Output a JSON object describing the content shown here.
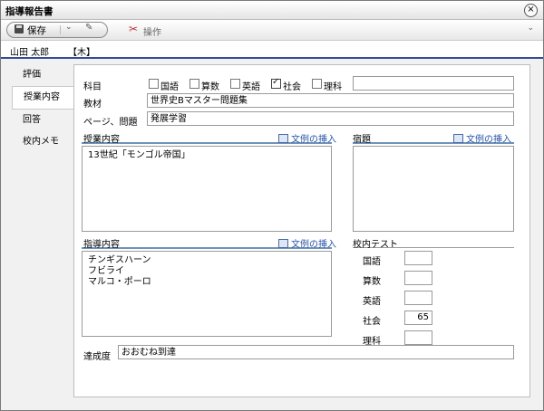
{
  "window": {
    "title": "指導報告書"
  },
  "toolbar": {
    "save_label": "保存",
    "operations_label": "操作"
  },
  "header": {
    "student_name": "山田 太郎",
    "day": "【木】"
  },
  "nav": {
    "items": [
      {
        "label": "評価"
      },
      {
        "label": "授業内容"
      },
      {
        "label": "回答"
      },
      {
        "label": "校内メモ"
      }
    ]
  },
  "form": {
    "subject_label": "科目",
    "subjects": [
      {
        "label": "国語",
        "checked": false
      },
      {
        "label": "算数",
        "checked": false
      },
      {
        "label": "英語",
        "checked": false
      },
      {
        "label": "社会",
        "checked": true
      },
      {
        "label": "理科",
        "checked": false
      }
    ],
    "subject_other_value": "",
    "material_label": "教材",
    "material_value": "世界史Bマスター問題集",
    "page_label": "ページ、問題",
    "page_value": "発展学習",
    "insert_label": "文例の挿入",
    "lesson_label": "授業内容",
    "lesson_text": "13世紀「モンゴル帝国」",
    "homework_label": "宿題",
    "homework_text": "",
    "guidance_label": "指導内容",
    "guidance_lines": [
      "チンギスハーン",
      "フビライ",
      "マルコ・ポーロ"
    ],
    "school_test_label": "校内テスト",
    "tests": [
      {
        "subject": "国語",
        "score": ""
      },
      {
        "subject": "算数",
        "score": ""
      },
      {
        "subject": "英語",
        "score": ""
      },
      {
        "subject": "社会",
        "score": "65"
      },
      {
        "subject": "理科",
        "score": ""
      }
    ],
    "achievement_label": "達成度",
    "achievement_value": "おおむね到達"
  }
}
